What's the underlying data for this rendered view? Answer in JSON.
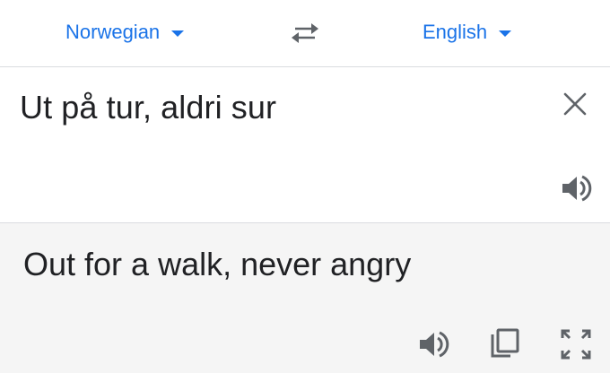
{
  "languages": {
    "source": "Norwegian",
    "target": "English"
  },
  "source": {
    "text": "Ut på tur, aldri sur"
  },
  "result": {
    "text": "Out for a walk, never angry"
  },
  "icons": {
    "dropdown": "chevron-down-icon",
    "swap": "swap-arrows-icon",
    "clear": "close-icon",
    "listen": "speaker-icon",
    "copy": "copy-icon",
    "fullscreen": "fullscreen-icon"
  },
  "colors": {
    "accent": "#1a73e8",
    "text": "#202124",
    "icon": "#5f6368",
    "result_background": "#f5f5f5",
    "divider": "#dadce0"
  }
}
